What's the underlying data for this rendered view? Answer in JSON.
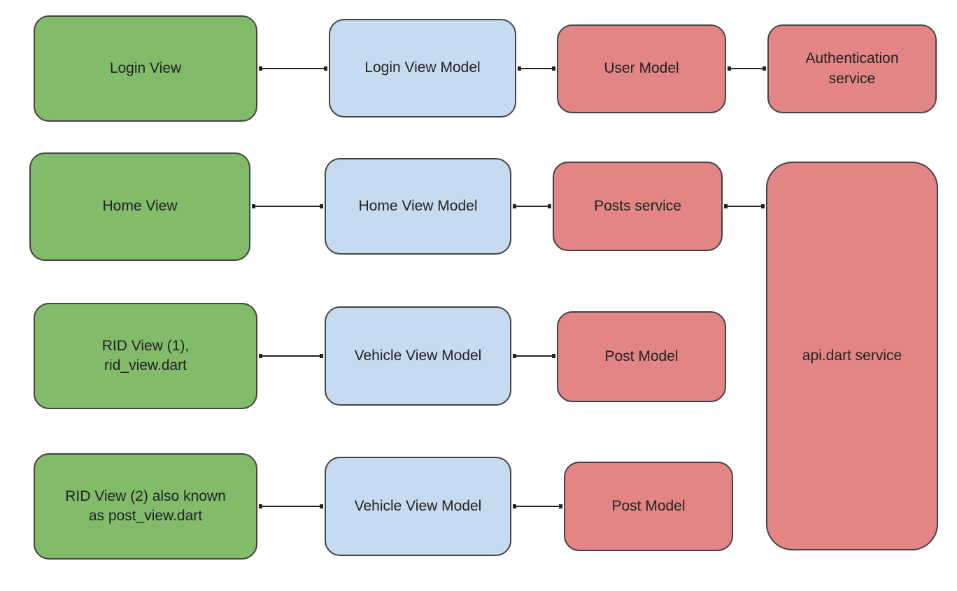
{
  "colors": {
    "view": "#82bb6a",
    "view_model": "#c6dbef",
    "model_service": "#e38585"
  },
  "nodes": {
    "login_view": "Login View",
    "login_view_model": "Login View Model",
    "user_model": "User Model",
    "authentication_service": "Authentication\nservice",
    "home_view": "Home View",
    "home_view_model": "Home View Model",
    "posts_service": "Posts service",
    "api_service": "api.dart service",
    "rid_view_1": "RID View (1),\nrid_view.dart",
    "vehicle_view_model_1": "Vehicle View Model",
    "post_model_1": "Post Model",
    "rid_view_2": "RID View (2) also known\nas post_view.dart",
    "vehicle_view_model_2": "Vehicle View Model",
    "post_model_2": "Post Model"
  },
  "edges": [
    [
      "login_view",
      "login_view_model"
    ],
    [
      "login_view_model",
      "user_model"
    ],
    [
      "user_model",
      "authentication_service"
    ],
    [
      "home_view",
      "home_view_model"
    ],
    [
      "home_view_model",
      "posts_service"
    ],
    [
      "posts_service",
      "api_service"
    ],
    [
      "rid_view_1",
      "vehicle_view_model_1"
    ],
    [
      "vehicle_view_model_1",
      "post_model_1"
    ],
    [
      "rid_view_2",
      "vehicle_view_model_2"
    ],
    [
      "vehicle_view_model_2",
      "post_model_2"
    ]
  ]
}
